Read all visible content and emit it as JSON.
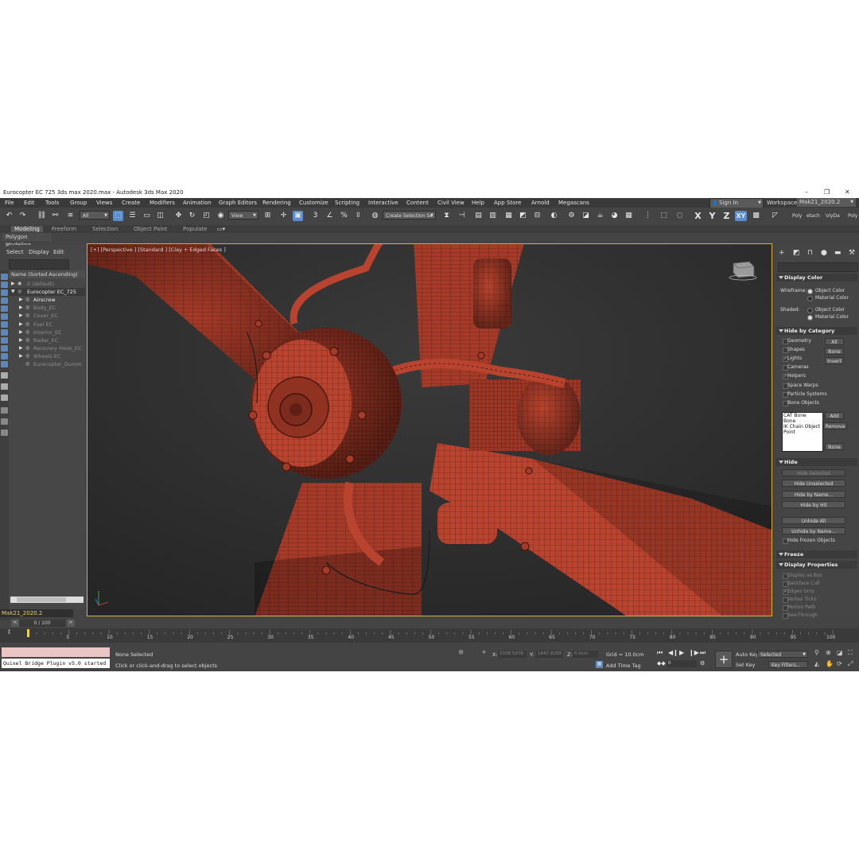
{
  "window": {
    "title": "Eurocopter EC 725 3ds max 2020.max - Autodesk 3ds Max 2020",
    "minimize": "–",
    "maximize": "❐",
    "close": "✕"
  },
  "menubar": {
    "items": [
      "File",
      "Edit",
      "Tools",
      "Group",
      "Views",
      "Create",
      "Modifiers",
      "Animation",
      "Graph Editors",
      "Rendering",
      "Customize",
      "Scripting",
      "Interactive",
      "Content",
      "Civil View",
      "Help",
      "App Store",
      "Arnold",
      "Megascans"
    ],
    "signin": "Sign In",
    "workspaces_label": "Workspaces:",
    "workspace": "Mak21_2020.2"
  },
  "toolbar": {
    "selection_filter": "All",
    "ref_coord": "View",
    "named_selection": "Create Selection Se",
    "axis_x": "X",
    "axis_y": "Y",
    "axis_z": "Z",
    "axis_xy": "XY",
    "right_labels": [
      "Poly",
      "etach",
      "'olyDa",
      "Poly"
    ]
  },
  "ribbon": {
    "tabs": [
      "Modeling",
      "Freeform",
      "Selection",
      "Object Paint",
      "Populate"
    ],
    "active_tab": "Modeling",
    "panel": "Polygon Modeling"
  },
  "explorer": {
    "menu": [
      "Select",
      "Display",
      "Edit"
    ],
    "header": "Name (Sorted Ascending)",
    "rows": [
      {
        "name": "0 (default)",
        "indent": 1,
        "dim": true,
        "arrow": true
      },
      {
        "name": "Eurocopter EC_725",
        "indent": 1,
        "dim": false,
        "arrow": true,
        "selected": true
      },
      {
        "name": "Airscrew",
        "indent": 2,
        "dim": false,
        "arrow": true
      },
      {
        "name": "Body_EC",
        "indent": 2,
        "dim": true,
        "arrow": true
      },
      {
        "name": "Cover_EC",
        "indent": 2,
        "dim": true,
        "arrow": true
      },
      {
        "name": "Fuel EC",
        "indent": 2,
        "dim": true,
        "arrow": true
      },
      {
        "name": "Interior_EC",
        "indent": 2,
        "dim": true,
        "arrow": true
      },
      {
        "name": "Radar_EC",
        "indent": 2,
        "dim": true,
        "arrow": true
      },
      {
        "name": "Recovery Hook_EC",
        "indent": 2,
        "dim": true,
        "arrow": true
      },
      {
        "name": "Wheels EC",
        "indent": 2,
        "dim": true,
        "arrow": true
      },
      {
        "name": "Eurocopter_Dumm",
        "indent": 2,
        "dim": true,
        "arrow": false
      }
    ],
    "layer": "Mak21_2020.2"
  },
  "viewport": {
    "label": "[+] [Perspective ] [Standard ] [Clay + Edged Faces ]"
  },
  "cmdpanel": {
    "display_color": {
      "title": "Display Color",
      "wireframe_label": "Wireframe:",
      "shaded_label": "Shaded:",
      "object_color": "Object Color",
      "material_color": "Material Color"
    },
    "hide_by_category": {
      "title": "Hide by Category",
      "items": [
        {
          "label": "Geometry",
          "checked": false
        },
        {
          "label": "Shapes",
          "checked": false
        },
        {
          "label": "Lights",
          "checked": true
        },
        {
          "label": "Cameras",
          "checked": false
        },
        {
          "label": "Helpers",
          "checked": true
        },
        {
          "label": "Space Warps",
          "checked": false
        },
        {
          "label": "Particle Systems",
          "checked": false
        },
        {
          "label": "Bone Objects",
          "checked": false
        }
      ],
      "btn_all": "All",
      "btn_none": "None",
      "btn_invert": "Invert",
      "list": [
        "CAT Bone",
        "Bone",
        "IK Chain Object",
        "Point"
      ],
      "btn_add": "Add",
      "btn_remove": "Remove",
      "btn_none2": "None"
    },
    "hide": {
      "title": "Hide",
      "buttons": [
        {
          "label": "Hide Selected",
          "dim": true
        },
        {
          "label": "Hide Unselected",
          "dim": false
        },
        {
          "label": "Hide by Name...",
          "dim": false
        },
        {
          "label": "Hide by Hit",
          "dim": false
        },
        {
          "label": "Unhide All",
          "dim": false
        },
        {
          "label": "Unhide by Name...",
          "dim": false
        }
      ],
      "hide_frozen": "Hide Frozen Objects"
    },
    "freeze": {
      "title": "Freeze"
    },
    "display_properties": {
      "title": "Display Properties",
      "items": [
        {
          "label": "Display as Box",
          "checked": false
        },
        {
          "label": "Backface Cull",
          "checked": false
        },
        {
          "label": "Edges Only",
          "checked": true
        },
        {
          "label": "Vertex Ticks",
          "checked": false
        },
        {
          "label": "Motion Path",
          "checked": false
        },
        {
          "label": "See-Through",
          "checked": false
        }
      ]
    }
  },
  "timeline": {
    "value": "0 / 100",
    "back": "<",
    "fwd": ">",
    "ticks": [
      "5",
      "10",
      "15",
      "20",
      "25",
      "30",
      "35",
      "40",
      "45",
      "50",
      "55",
      "60",
      "65",
      "70",
      "75",
      "80",
      "85",
      "90",
      "95",
      "100"
    ],
    "end_label": "100"
  },
  "status": {
    "maxscript": "Quixel Bridge Plugin v5.0 started",
    "none_selected": "None Selected",
    "prompt": "Click or click-and-drag to select objects",
    "x_label": "X:",
    "x_value": "3338.5478",
    "y_label": "Y:",
    "y_value": "1847.9299",
    "z_label": "Z:",
    "z_value": "0.0cm",
    "grid": "Grid = 10.0cm",
    "add_time_tag": "Add Time Tag",
    "auto_key": "Auto Key",
    "set_key": "Set Key",
    "selected": "Selected",
    "key_filters": "Key Filters...",
    "frame": "0"
  }
}
